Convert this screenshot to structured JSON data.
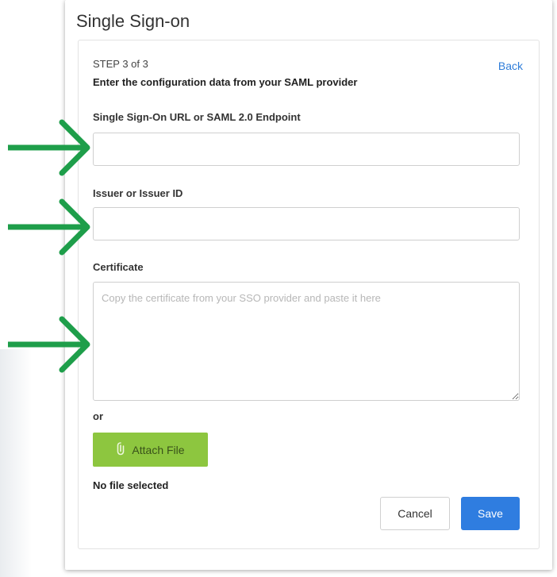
{
  "dialog": {
    "title": "Single Sign-on"
  },
  "step": {
    "indicator": "STEP 3 of 3",
    "instruction": "Enter the configuration data from your SAML provider",
    "back_label": "Back"
  },
  "fields": {
    "sso_url_label": "Single Sign-On URL or SAML 2.0 Endpoint",
    "sso_url_value": "",
    "issuer_label": "Issuer or Issuer ID",
    "issuer_value": "",
    "certificate_label": "Certificate",
    "certificate_placeholder": "Copy the certificate from your SSO provider and paste it here",
    "certificate_value": ""
  },
  "attach": {
    "or_label": "or",
    "button_label": "Attach File",
    "file_status": "No file selected"
  },
  "actions": {
    "cancel_label": "Cancel",
    "save_label": "Save"
  },
  "annotations": {
    "arrow_color": "#1e9e4a",
    "arrow_icon": "right-arrow-icon"
  },
  "colors": {
    "accent_blue": "#2f7de0",
    "attach_green": "#8dc63f"
  }
}
